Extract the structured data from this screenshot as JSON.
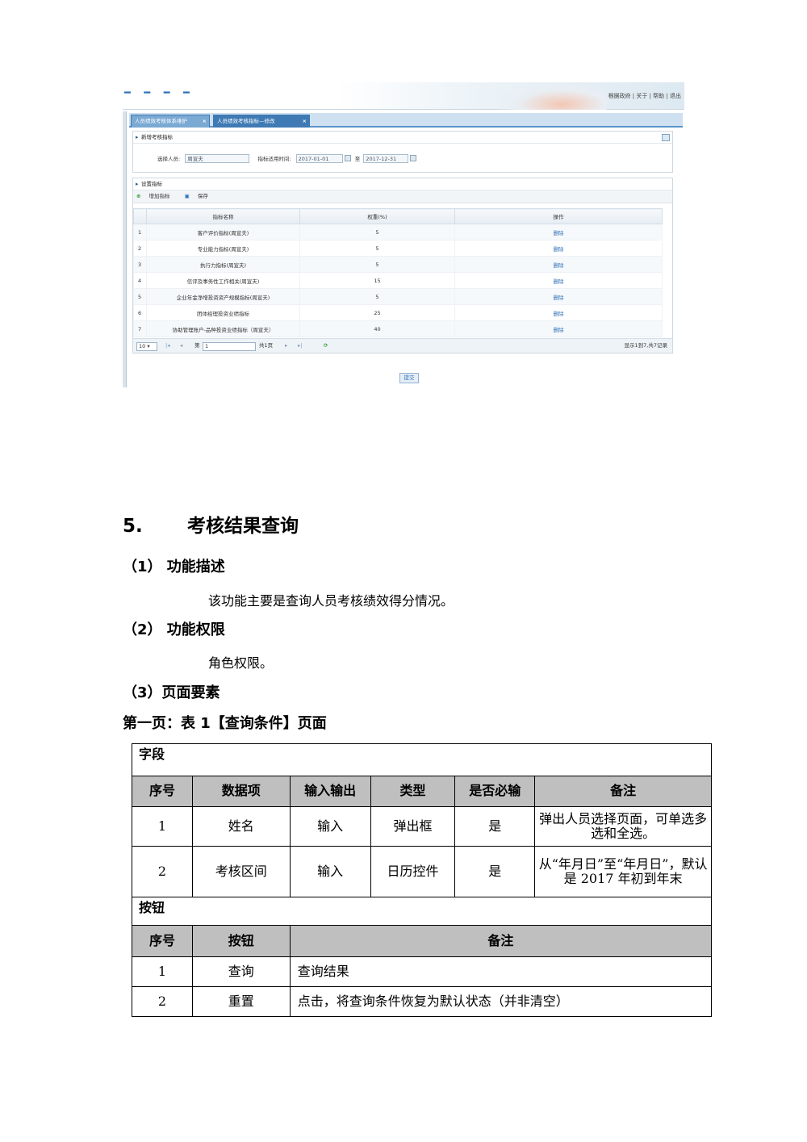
{
  "screenshot": {
    "top_links": "根据政府 | 关于 | 帮助 | 退出",
    "tabs": [
      {
        "label": "人员绩效考核体系维护",
        "close": "×"
      },
      {
        "label": "人员绩效考核指标—修改",
        "close": "×"
      }
    ],
    "panel_new": {
      "title": "新增考核指标",
      "person_label": "选择人员:",
      "person_value": "周宣夫",
      "period_label": "指标适用时间:",
      "date_from": "2017-01-01",
      "date_to_label": "至",
      "date_to": "2017-12-31"
    },
    "panel_set": {
      "title": "设置指标",
      "add_label": "增加指标",
      "save_label": "保存",
      "columns": [
        "指标名称",
        "权重(%)",
        "操作"
      ],
      "rows": [
        {
          "no": "1",
          "name": "客户评价指标(周宣夫)",
          "weight": "5",
          "op": "删除"
        },
        {
          "no": "2",
          "name": "专业能力指标(周宣夫)",
          "weight": "5",
          "op": "删除"
        },
        {
          "no": "3",
          "name": "执行力指标(周宣夫)",
          "weight": "5",
          "op": "删除"
        },
        {
          "no": "4",
          "name": "信评及事务性工作相关(周宣夫)",
          "weight": "15",
          "op": "删除"
        },
        {
          "no": "5",
          "name": "企业年金净增投资资产规模指标(周宣夫)",
          "weight": "5",
          "op": "删除"
        },
        {
          "no": "6",
          "name": "团体经理投资业绩指标",
          "weight": "25",
          "op": "删除"
        },
        {
          "no": "7",
          "name": "协助管理账户-品种投资业绩指标（周宣夫）",
          "weight": "40",
          "op": "删除"
        }
      ],
      "pager": {
        "page_size": "10",
        "page_prefix": "第",
        "page_value": "1",
        "total_pages": "共1页",
        "info": "显示1到7,共7记录"
      }
    },
    "submit_label": "提交"
  },
  "section": {
    "number": "5.",
    "title": "考核结果查询",
    "sub1": "（1） 功能描述",
    "sub1_text": "该功能主要是查询人员考核绩效得分情况。",
    "sub2": "（2） 功能权限",
    "sub2_text": "角色权限。",
    "sub3": "（3）页面要素",
    "caption": "第一页：表 1【查询条件】页面"
  },
  "spec_table": {
    "fields_label": "字段",
    "field_headers": [
      "序号",
      "数据项",
      "输入输出",
      "类型",
      "是否必输",
      "备注"
    ],
    "field_rows": [
      {
        "no": "1",
        "item": "姓名",
        "io": "输入",
        "type": "弹出框",
        "required": "是",
        "remark": "弹出人员选择页面，可单选多选和全选。"
      },
      {
        "no": "2",
        "item": "考核区间",
        "io": "输入",
        "type": "日历控件",
        "required": "是",
        "remark": "从“年月日”至“年月日”，默认是 2017 年初到年末"
      }
    ],
    "buttons_label": "按钮",
    "button_headers": [
      "序号",
      "按钮",
      "备注"
    ],
    "button_rows": [
      {
        "no": "1",
        "button": "查询",
        "remark": "查询结果"
      },
      {
        "no": "2",
        "button": "重置",
        "remark": "点击，将查询条件恢复为默认状态（并非清空）"
      }
    ]
  }
}
